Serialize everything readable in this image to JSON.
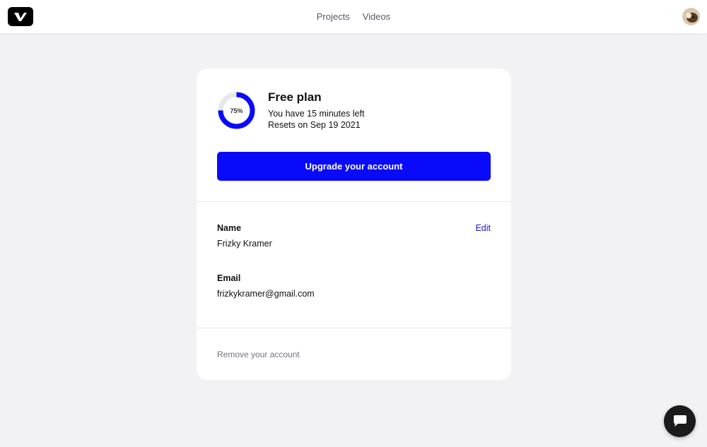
{
  "nav": {
    "logo_icon": "vimeo-v-logo-icon",
    "items": [
      "Projects",
      "Videos"
    ],
    "avatar_icon": "user-avatar-icon"
  },
  "plan": {
    "usage_percent_label": "75%",
    "usage_fraction": 0.75,
    "title": "Free plan",
    "line1": "You have 15 minutes left",
    "line2": "Resets on Sep 19 2021",
    "upgrade_label": "Upgrade your account",
    "accent_color": "#0a0afa"
  },
  "profile": {
    "name_label": "Name",
    "name_value": "Frizky Kramer",
    "edit_label": "Edit",
    "email_label": "Email",
    "email_value": "frizkykramer@gmail.com"
  },
  "danger": {
    "remove_label": "Remove your account"
  },
  "chat": {
    "icon": "chat-bubble-icon"
  }
}
